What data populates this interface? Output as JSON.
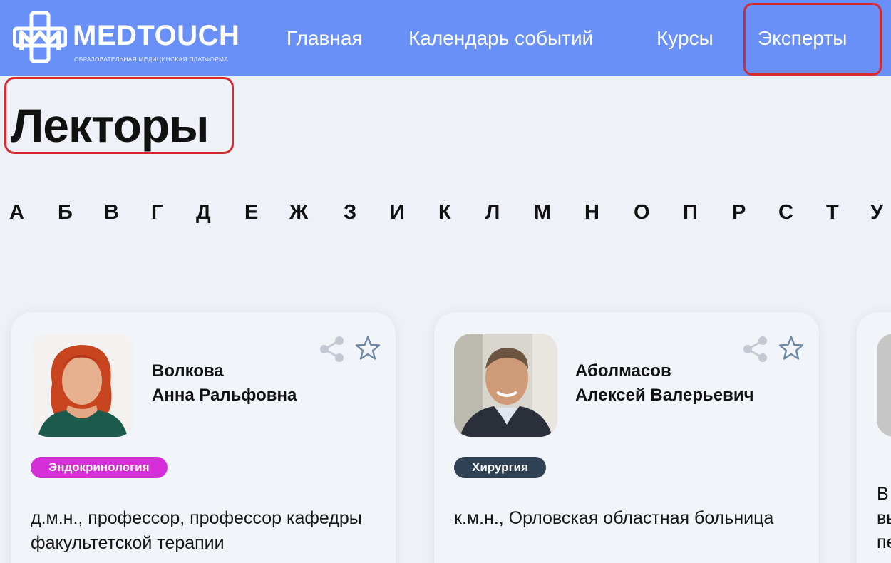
{
  "header": {
    "logo_text": "MEDTOUCH",
    "logo_subtitle": "ОБРАЗОВАТЕЛЬНАЯ МЕДИЦИНСКАЯ ПЛАТФОРМА",
    "nav": [
      "Главная",
      "Календарь событий",
      "Курсы",
      "Эксперты"
    ],
    "accent_color": "#6990f8"
  },
  "page": {
    "title": "Лекторы"
  },
  "alphabet": [
    "А",
    "Б",
    "В",
    "Г",
    "Д",
    "Е",
    "Ж",
    "З",
    "И",
    "К",
    "Л",
    "М",
    "Н",
    "О",
    "П",
    "Р",
    "С",
    "Т",
    "У"
  ],
  "lecturers": [
    {
      "surname": "Волкова",
      "given_names": "Анна Ральфовна",
      "specialty": "Эндокринология",
      "specialty_color": "#d62fd9",
      "description": "д.м.н., профессор, профессор кафедры факультетской терапии"
    },
    {
      "surname": "Аболмасов",
      "given_names": "Алексей Валерьевич",
      "specialty": "Хирургия",
      "specialty_color": "#2e4155",
      "description": "к.м.н., Орловская областная больница"
    },
    {
      "description_fragment": [
        "В",
        "вы",
        "пе"
      ]
    }
  ],
  "icons": [
    "share-icon",
    "star-icon"
  ]
}
